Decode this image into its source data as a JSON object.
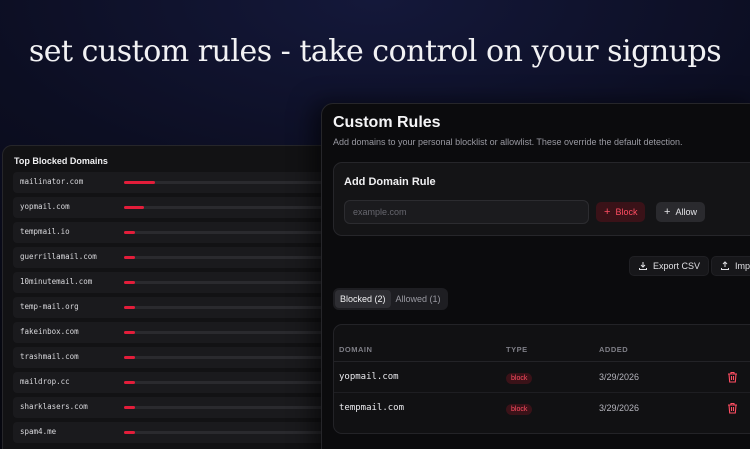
{
  "headline": "set custom rules - take control on your signups",
  "colors": {
    "accent_red": "#e21d3a",
    "block_text": "#ff4d62"
  },
  "top_blocked": {
    "title": "Top Blocked Domains",
    "rows": [
      {
        "domain": "mailinator.com",
        "share": 0.14
      },
      {
        "domain": "yopmail.com",
        "share": 0.09
      },
      {
        "domain": "tempmail.io",
        "share": 0.05
      },
      {
        "domain": "guerrillamail.com",
        "share": 0.05
      },
      {
        "domain": "10minutemail.com",
        "share": 0.05
      },
      {
        "domain": "temp-mail.org",
        "share": 0.05
      },
      {
        "domain": "fakeinbox.com",
        "share": 0.05
      },
      {
        "domain": "trashmail.com",
        "share": 0.05
      },
      {
        "domain": "maildrop.cc",
        "share": 0.05
      },
      {
        "domain": "sharklasers.com",
        "share": 0.05
      },
      {
        "domain": "spam4.me",
        "share": 0.05
      }
    ]
  },
  "custom_rules": {
    "title": "Custom Rules",
    "subtitle": "Add domains to your personal blocklist or allowlist. These override the default detection.",
    "add_card": {
      "title": "Add Domain Rule",
      "input_placeholder": "example.com",
      "block_label": "Block",
      "allow_label": "Allow"
    },
    "export_label": "Export CSV",
    "import_label": "Impo",
    "tabs": [
      {
        "label": "Blocked (2)",
        "active": true
      },
      {
        "label": "Allowed (1)",
        "active": false
      }
    ],
    "table": {
      "headers": {
        "domain": "DOMAIN",
        "type": "TYPE",
        "added": "ADDED"
      },
      "rows": [
        {
          "domain": "yopmail.com",
          "type": "block",
          "added": "3/29/2026"
        },
        {
          "domain": "tempmail.com",
          "type": "block",
          "added": "3/29/2026"
        }
      ]
    }
  }
}
